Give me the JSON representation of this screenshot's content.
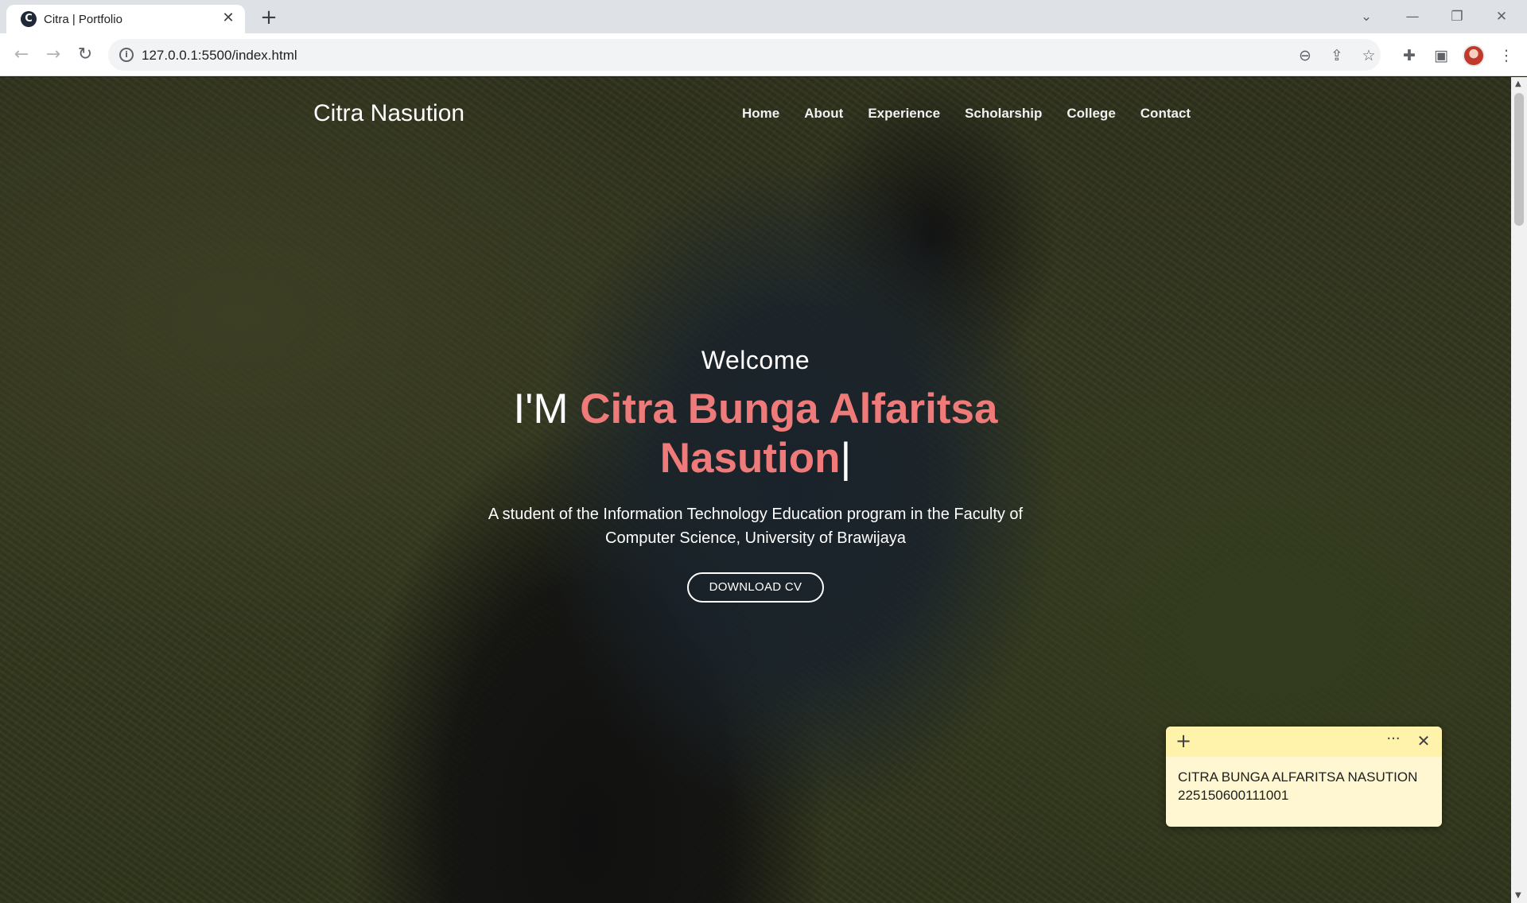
{
  "browser": {
    "tab_title": "Citra | Portfolio",
    "favicon": "c-logo-icon",
    "url": "127.0.0.1:5500/index.html",
    "icons": {
      "back": "arrow-left-icon",
      "forward": "arrow-right-icon",
      "reload": "reload-icon",
      "info": "info-icon",
      "zoom": "zoom-out-icon",
      "share": "share-icon",
      "bookmark": "star-icon",
      "extensions": "puzzle-icon",
      "side_panel": "side-panel-icon",
      "menu": "kebab-menu-icon"
    }
  },
  "site": {
    "brand": "Citra Nasution",
    "nav": [
      "Home",
      "About",
      "Experience",
      "Scholarship",
      "College",
      "Contact"
    ]
  },
  "hero": {
    "welcome": "Welcome",
    "prefix": "I'M ",
    "name": "Citra Bunga Alfaritsa Nasution",
    "cursor": "|",
    "tagline": "A student of the Information Technology Education program in the Faculty of Computer Science, University of Brawijaya",
    "cta": "DOWNLOAD CV",
    "accent_color": "#ee7a7a"
  },
  "sticky_note": {
    "line1": "CITRA BUNGA ALFARITSA NASUTION",
    "line2": "225150600111001",
    "background": "#fff7d1"
  }
}
